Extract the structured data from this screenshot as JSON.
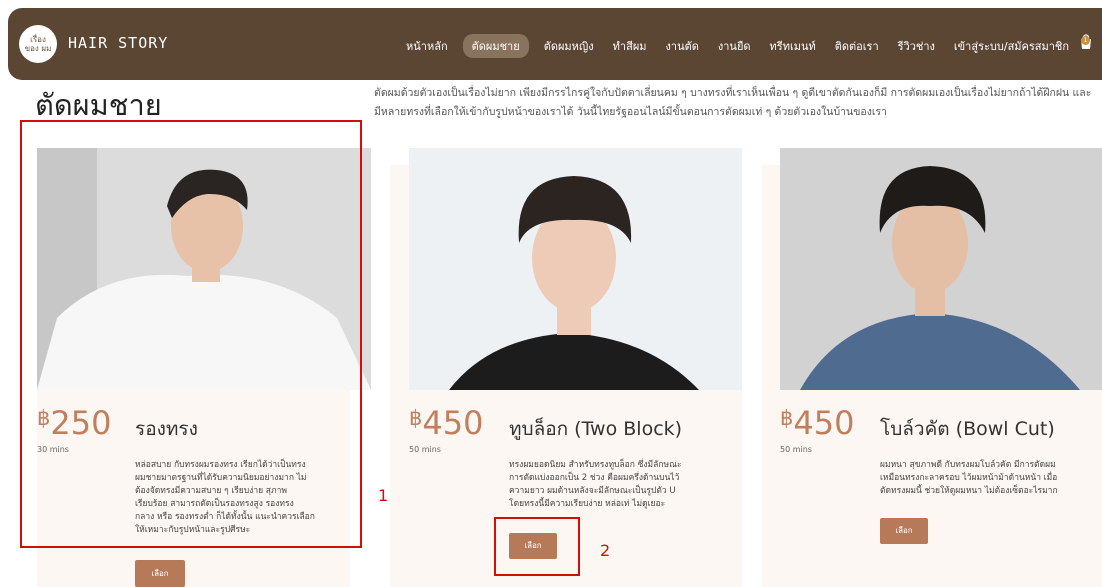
{
  "brand": {
    "logo_text": "เรื่อง ของ ผม",
    "name": "HAIR STORY"
  },
  "nav": {
    "items": [
      {
        "label": "หน้าหลัก",
        "active": false
      },
      {
        "label": "ตัดผมชาย",
        "active": true
      },
      {
        "label": "ตัดผมหญิง",
        "active": false
      },
      {
        "label": "ทำสีผม",
        "active": false
      },
      {
        "label": "งานตัด",
        "active": false
      },
      {
        "label": "งานยืด",
        "active": false
      },
      {
        "label": "ทรีทเมนท์",
        "active": false
      },
      {
        "label": "ติดต่อเรา",
        "active": false
      },
      {
        "label": "รีวิวช่าง",
        "active": false
      },
      {
        "label": "เข้าสู่ระบบ/สมัครสมาชิก",
        "active": false
      }
    ],
    "cart_icon": "cart-icon",
    "cart_count": "1"
  },
  "page": {
    "title": "ตัดผมชาย",
    "intro_line1": "ตัดผมด้วยตัวเองเป็นเรื่องไม่ยาก เพียงมีกรรไกรคู่ใจกับปัตตาเลี่ยนคม ๆ บางทรงที่เราเห็นเพื่อน ๆ ดูดีเขาตัดกันเองก็มี การตัดผมเองเป็นเรื่องไม่ยากถ้าได้ฝึกฝน และ",
    "intro_line2": "มีหลายทรงที่เลือกให้เข้ากับรูปหน้าของเราได้ วันนี้ไทยรัฐออนไลน์มีขั้นตอนการตัดผมเท่ ๆ ด้วยตัวเองในบ้านของเรา"
  },
  "cards": [
    {
      "currency": "฿",
      "price": "250",
      "name": "รองทรง",
      "duration": "30 mins",
      "desc_lines": [
        "หล่อสบาย กับทรงผมรองทรง เรียกได้ว่าเป็นทรง",
        "ผมชายมาตรฐานที่ได้รับความนิยมอย่างมาก ไม่",
        "ต้องจัดทรงมีความสบาย ๆ เรียบง่าย สุภาพ",
        "เรียบร้อย สามารถตัดเป็นรองทรงสูง รองทรง",
        "กลาง หรือ รองทรงต่ำ ก็ได้ทั้งนั้น แนะนำควรเลือก",
        "ให้เหมาะกับรูปหน้าและรูปศีรษะ"
      ],
      "button": "เลือก"
    },
    {
      "currency": "฿",
      "price": "450",
      "name": "ทูบล็อก (Two Block)",
      "duration": "50 mins",
      "desc_lines": [
        "ทรงผมยอดนิยม สำหรับทรงทูบล็อก ซึ่งมีลักษณะ",
        "การตัดแบ่งออกเป็น 2 ช่วง คือผมครึ่งด้านบนไว้",
        "ความยาว ผมด้านหลังจะมีลักษณะเป็นรูปตัว U",
        "โดยทรงนี้มีความเรียบง่าย หล่อเท่ ไม่ดูเยอะ"
      ],
      "button": "เลือก"
    },
    {
      "currency": "฿",
      "price": "450",
      "name": "โบล์วคัต (Bowl Cut)",
      "duration": "50 mins",
      "desc_lines": [
        "ผมหนา สุขภาพดี กับทรงผมโบล์วคัต มีการตัดผม",
        "เหมือนทรงกะลาครอบ ไว้ผมหน้าม้าด้านหน้า เมื่อ",
        "ตัดทรงผมนี้ ช่วยให้ดูผมหนา ไม่ต้องเซ็ตอะไรมาก"
      ],
      "button": "เลือก"
    }
  ],
  "annotations": {
    "label_1": "1",
    "label_2": "2"
  }
}
